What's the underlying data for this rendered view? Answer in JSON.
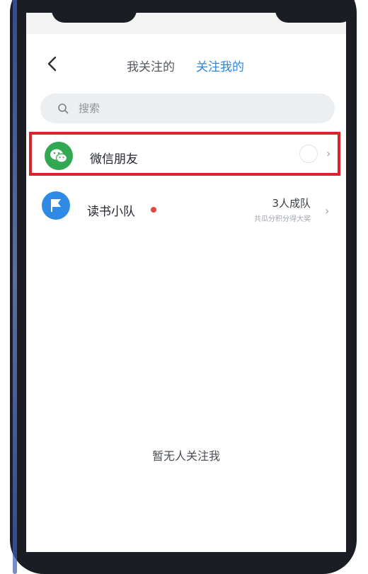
{
  "header": {
    "tabs": [
      {
        "label": "我关注的",
        "active": false
      },
      {
        "label": "关注我的",
        "active": true
      }
    ]
  },
  "search": {
    "placeholder": "搜索"
  },
  "rows": {
    "wechat": {
      "label": "微信朋友",
      "icon": "wechat-icon"
    },
    "team": {
      "label": "读书小队",
      "icon": "flag-icon",
      "status": "3人成队",
      "subtitle": "共瓜分积分得大奖"
    }
  },
  "empty_state": {
    "text": "暂无人关注我"
  },
  "colors": {
    "accent": "#2f86d8",
    "wechat_green": "#33a853",
    "team_blue": "#2f8ae6",
    "highlight_red": "#d9232d",
    "badge_dot": "#e4473a"
  }
}
